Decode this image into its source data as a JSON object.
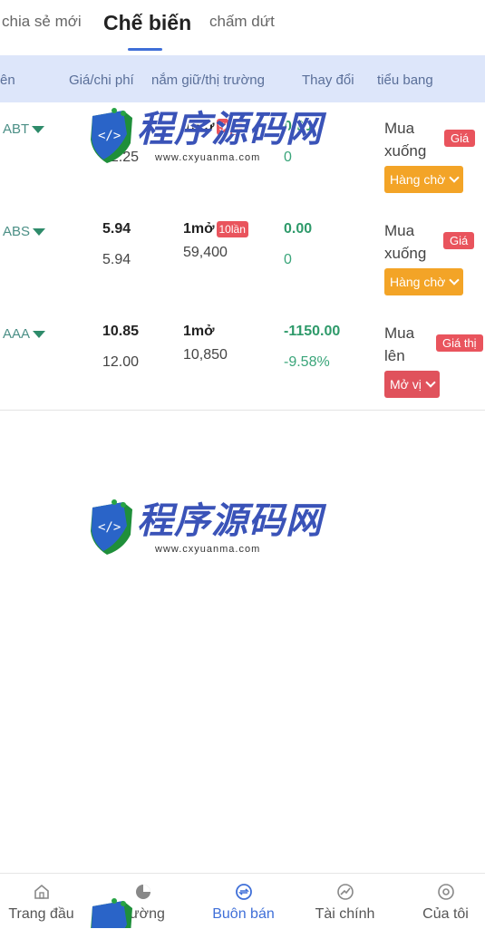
{
  "tabs": [
    {
      "label": "chia sẻ mới"
    },
    {
      "label": "Chế biến"
    },
    {
      "label": "chấm dứt"
    }
  ],
  "table": {
    "headers": [
      "ên",
      "Giá/chi phí",
      "nắm giữ/thị trường",
      "Thay đổi",
      "tiểu bang"
    ],
    "rows": [
      {
        "symbol": "ABT",
        "price": "",
        "cost": "32.25",
        "hold": "1mở",
        "hold_badge": "5lần",
        "market": "",
        "change": "0.00",
        "change_pct": "0",
        "state": "Mua xuống",
        "price_tag": "Giá",
        "action": "Hàng chờ"
      },
      {
        "symbol": "ABS",
        "price": "5.94",
        "cost": "5.94",
        "hold": "1mở",
        "hold_badge": "10lần",
        "market": "59,400",
        "change": "0.00",
        "change_pct": "0",
        "state": "Mua xuống",
        "price_tag": "Giá",
        "action": "Hàng chờ"
      },
      {
        "symbol": "AAA",
        "price": "10.85",
        "cost": "12.00",
        "hold": "1mở",
        "hold_badge": "",
        "market": "10,850",
        "change": "-1150.00",
        "change_pct": "-9.58%",
        "state": "Mua lên",
        "price_tag": "Giá thị",
        "action": "Mở vị"
      }
    ]
  },
  "watermark": {
    "text": "程序源码网",
    "url": "www.cxyuanma.com"
  },
  "nav": [
    {
      "label": "Trang đầu",
      "icon": "home-icon"
    },
    {
      "label": "trường",
      "icon": "pie-chart-icon"
    },
    {
      "label": "Buôn bán",
      "icon": "trade-icon"
    },
    {
      "label": "Tài chính",
      "icon": "finance-icon"
    },
    {
      "label": "Của tôi",
      "icon": "profile-icon"
    }
  ],
  "colors": {
    "accent": "#3f6fd8",
    "header_bg": "#dde6fa",
    "up": "#2e9a6a",
    "badge_red": "#e9545d",
    "orange": "#f3a427"
  }
}
